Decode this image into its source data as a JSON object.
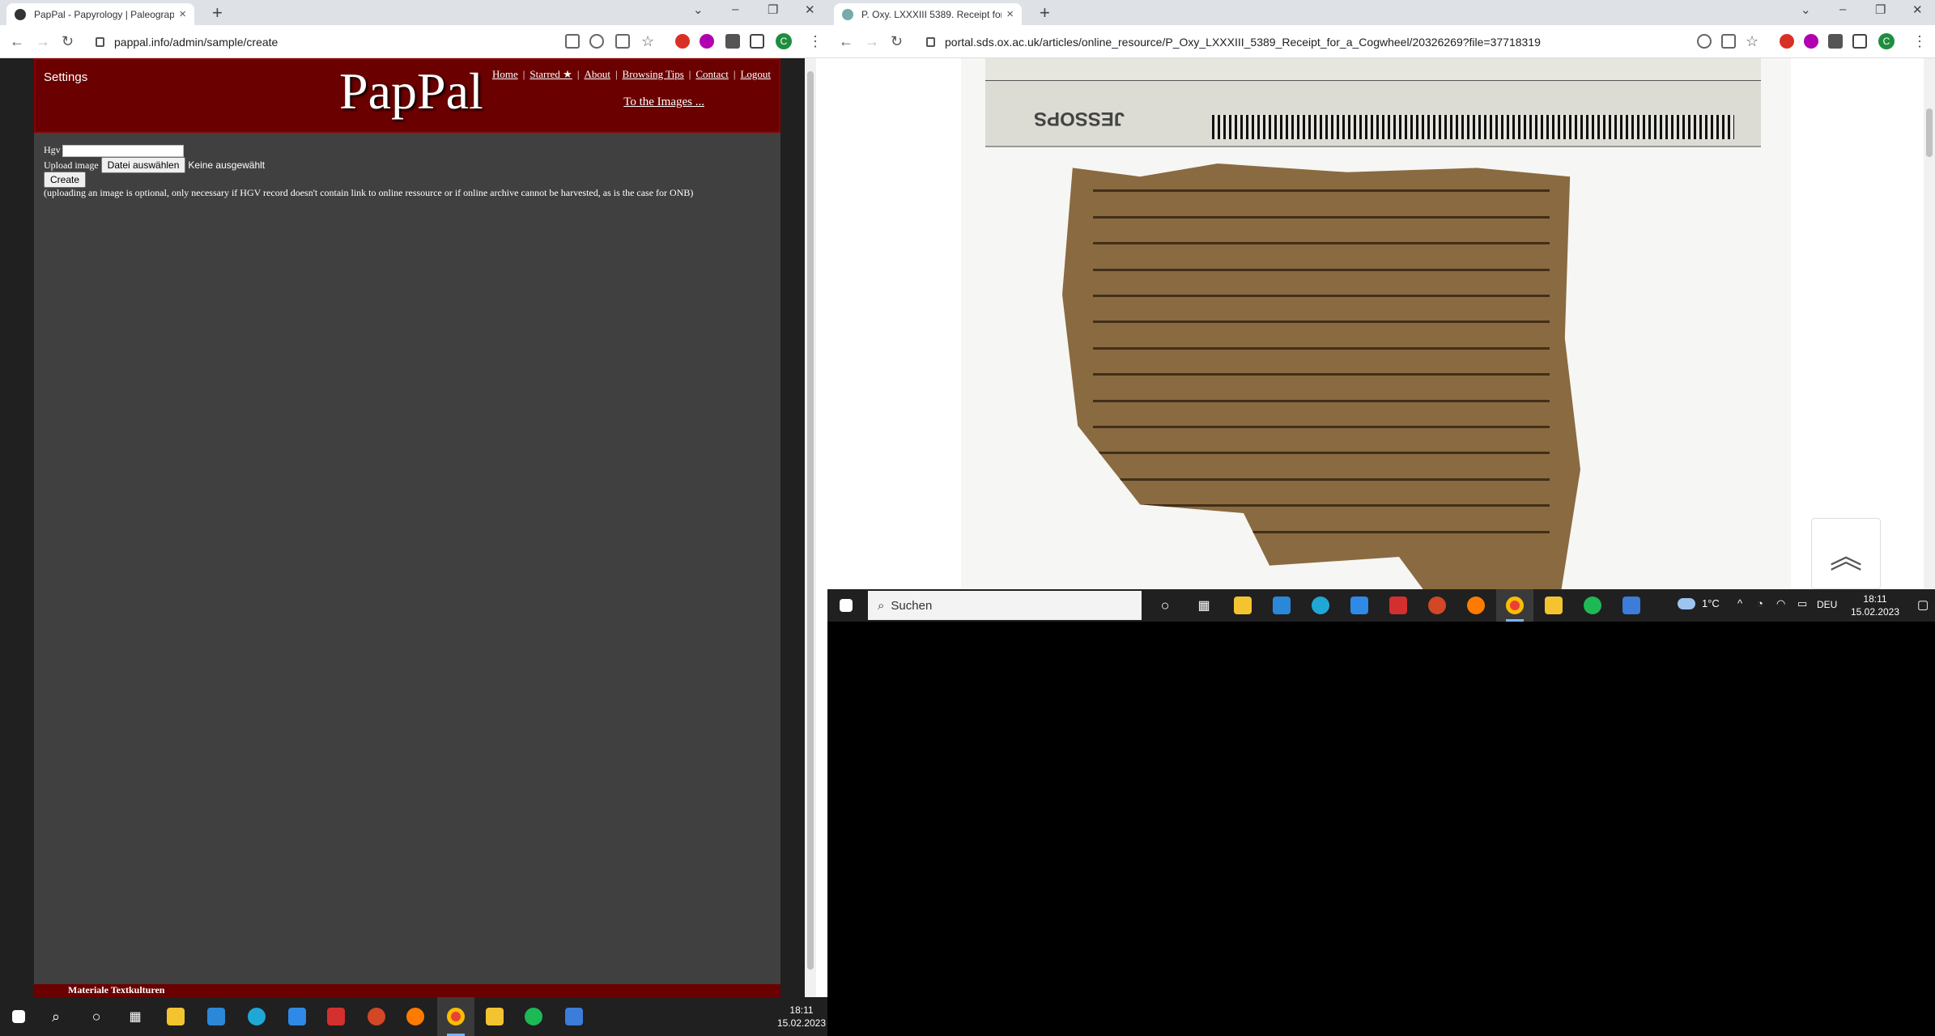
{
  "left_browser": {
    "tab_title": "PapPal - Papyrology | Paleograph",
    "url": "pappal.info/admin/sample/create",
    "page": {
      "settings_label": "Settings",
      "logo": "PapPal",
      "menu": [
        "Home",
        "Starred ★",
        "About",
        "Browsing Tips",
        "Contact",
        "Logout"
      ],
      "to_images": "To the Images ...",
      "hgv_label": "Hgv",
      "upload_label": "Upload image",
      "file_button": "Datei auswählen",
      "file_status": "Keine ausgewählt",
      "create_button": "Create",
      "note": "(uploading an image is optional, only necessary if HGV record doesn't contain link to online ressource or if online archive cannot be harvested, as is the case for ONB)",
      "footer_text": "Materiale Textkulturen"
    },
    "avatar_letter": "C"
  },
  "right_browser": {
    "tab_title": "P. Oxy. LXXXIII 5389. Receipt for a",
    "url": "portal.sds.ox.ac.uk/articles/online_resource/P_Oxy_LXXXIII_5389_Receipt_for_a_Cogwheel/20326269?file=37718319",
    "avatar_letter": "C",
    "ruler_brand": "JESSOPS"
  },
  "taskbar_left": {
    "time": "18:11",
    "date": "15.02.2023"
  },
  "taskbar_right": {
    "search_placeholder": "Suchen",
    "weather": "1°C",
    "lang": "DEU",
    "time": "18:11",
    "date": "15.02.2023"
  }
}
